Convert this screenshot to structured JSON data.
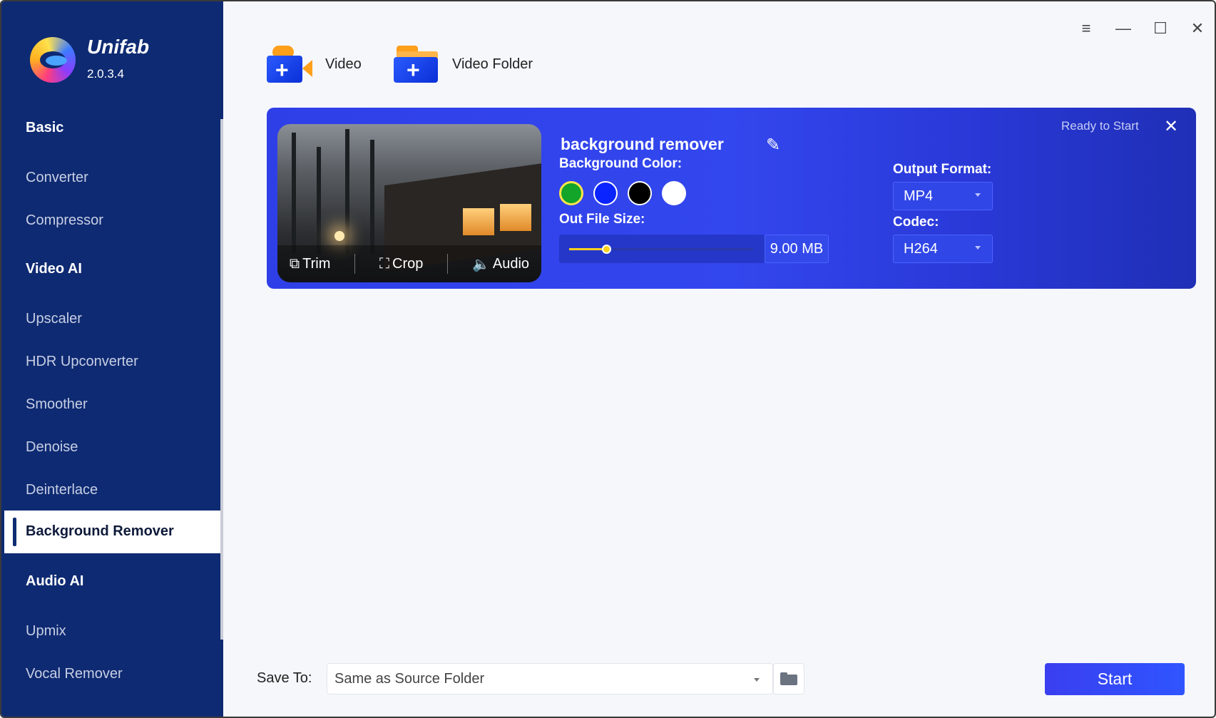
{
  "app": {
    "brand": "Unifab",
    "version": "2.0.3.4"
  },
  "sidebar": {
    "sections": [
      {
        "label": "Basic",
        "items": [
          "Converter",
          "Compressor"
        ]
      },
      {
        "label": "Video AI",
        "items": [
          "Upscaler",
          "HDR Upconverter",
          "Smoother",
          "Denoise",
          "Deinterlace",
          "Background Remover"
        ]
      },
      {
        "label": "Audio AI",
        "items": [
          "Upmix",
          "Vocal Remover"
        ]
      }
    ],
    "active_item": "Background Remover"
  },
  "toolbar": {
    "add_video": "Video",
    "add_folder": "Video Folder"
  },
  "window_controls": {
    "menu": "≡",
    "minimize": "—",
    "maximize": "☐",
    "close": "✕"
  },
  "task": {
    "title": "background remover",
    "status": "Ready to Start",
    "actions": {
      "trim": "Trim",
      "crop": "Crop",
      "audio": "Audio"
    },
    "background_color_label": "Background Color:",
    "colors": [
      "#13a42a",
      "#0a24ff",
      "#000000",
      "#ffffff"
    ],
    "selected_color": "#13a42a",
    "out_file_size_label": "Out File Size:",
    "file_size_value": "9.00 MB",
    "file_size_slider_fraction": 0.2,
    "output_format_label": "Output Format:",
    "output_format": "MP4",
    "codec_label": "Codec:",
    "codec": "H264"
  },
  "footer": {
    "save_to_label": "Save To:",
    "save_to_value": "Same as Source Folder",
    "start": "Start"
  }
}
